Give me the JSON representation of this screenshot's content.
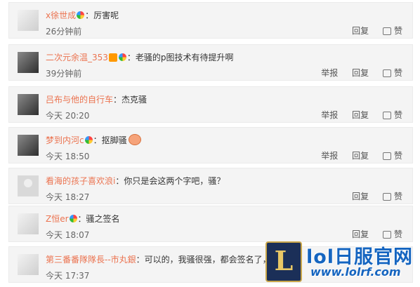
{
  "comments": [
    {
      "user": "x徐世成",
      "text": "：厉害呢",
      "time": "26分钟前",
      "report": "",
      "reply": "回复",
      "like": "赞"
    },
    {
      "user": "二次元余温_353",
      "text": "：老骚的p图技术有待提升啊",
      "time": "39分钟前",
      "report": "举报",
      "reply": "回复",
      "like": "赞"
    },
    {
      "user": "吕布与他的自行车",
      "text": "：杰克骚",
      "time": "今天 20:20",
      "report": "举报",
      "reply": "回复",
      "like": "赞"
    },
    {
      "user": "梦到内河c",
      "text": "：抠脚骚",
      "time": "今天 18:50",
      "report": "举报",
      "reply": "回复",
      "like": "赞"
    },
    {
      "user": "看海的孩子喜欢浪i",
      "text": "：你只是会这两个字吧，骚？",
      "time": "今天 18:27",
      "report": "",
      "reply": "回复",
      "like": "赞"
    },
    {
      "user": "Z恒er",
      "text": "：骚之签名",
      "time": "今天 18:07",
      "report": "",
      "reply": "回复",
      "like": "赞"
    },
    {
      "user": "第三番番隊隊長--市丸銀",
      "text": "：可以的，我骚很强，都会签名了，",
      "time": "今天 17:37",
      "report": "",
      "reply": "",
      "like": ""
    }
  ],
  "watermark": {
    "logo_letter": "L",
    "site_name": "lol日服官网",
    "url": "www.lolrf.com"
  }
}
